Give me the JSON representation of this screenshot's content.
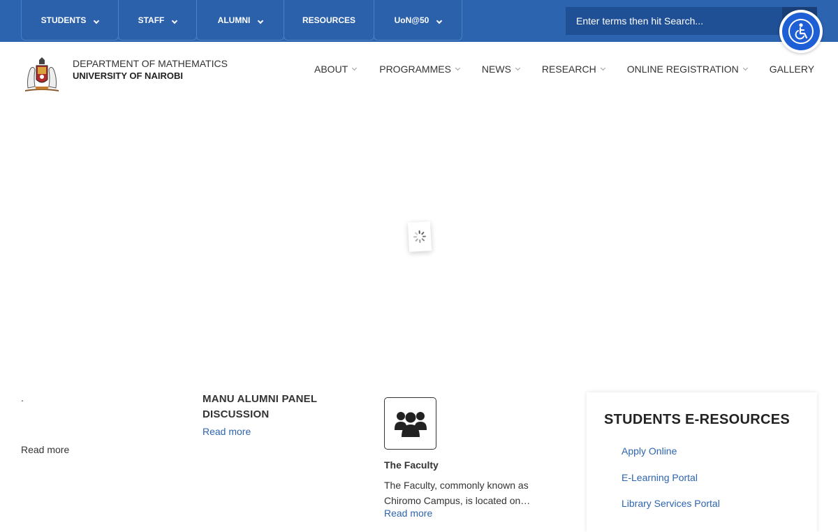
{
  "topnav": {
    "items": [
      {
        "label": "STUDENTS",
        "dropdown": true
      },
      {
        "label": "STAFF",
        "dropdown": true
      },
      {
        "label": "ALUMNI",
        "dropdown": true
      },
      {
        "label": "RESOURCES",
        "dropdown": false
      },
      {
        "label": "UoN@50",
        "dropdown": true
      }
    ],
    "search_placeholder": "Enter terms then hit Search..."
  },
  "header": {
    "dept_line1": "DEPARTMENT OF MATHEMATICS",
    "dept_line2": "UNIVERSITY OF NAIROBI"
  },
  "mainnav": {
    "items": [
      {
        "label": "ABOUT",
        "dropdown": true
      },
      {
        "label": "PROGRAMMES",
        "dropdown": true
      },
      {
        "label": "NEWS",
        "dropdown": true
      },
      {
        "label": "RESEARCH",
        "dropdown": true
      },
      {
        "label": "ONLINE REGISTRATION",
        "dropdown": true
      },
      {
        "label": "GALLERY",
        "dropdown": false
      }
    ]
  },
  "content": {
    "col1": {
      "dot": ".",
      "read_more": "Read more"
    },
    "col2": {
      "title": "MANU ALUMNI PANEL DISCUSSION",
      "read_more": "Read more"
    },
    "col3": {
      "icon": "group-icon",
      "title": "The Faculty",
      "text": "The Faculty, commonly known as Chiromo Campus, is located on…",
      "read_more": "Read more"
    }
  },
  "eresources": {
    "title": "STUDENTS E-RESOURCES",
    "links": [
      "Apply Online",
      "E-Learning Portal",
      "Library Services Portal"
    ]
  },
  "colors": {
    "brand_blue": "#2d64b0",
    "accessibility_blue": "#1f5fd6"
  }
}
